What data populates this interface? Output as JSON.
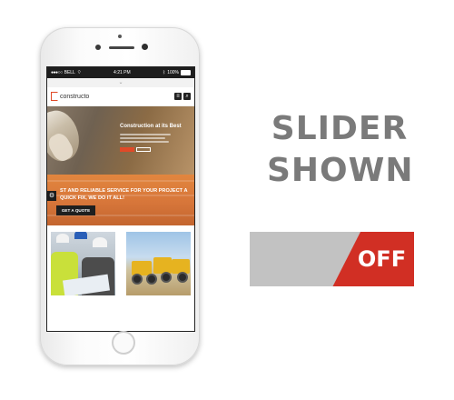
{
  "status_bar": {
    "carrier": "BELL",
    "time": "4:21 PM",
    "battery": "100%"
  },
  "site": {
    "logo_text": "constructo",
    "hero_title": "Construction at its Best",
    "promo_text": "ST AND RELIABLE SERVICE FOR YOUR PROJECT A QUICK FIX, WE DO IT ALL!",
    "quote_button": "GET A QUOTE"
  },
  "icons": {
    "menu": "menu-icon",
    "search": "search-icon",
    "settings": "gear-icon",
    "chevron": "chevron-down-icon"
  },
  "panel": {
    "title": "SLIDER SHOWN",
    "toggle_label": "OFF"
  },
  "colors": {
    "accent": "#d12f24",
    "toggle_off": "#c2c2c2",
    "heading": "#7a7a7a",
    "promo": "#d7763a"
  }
}
